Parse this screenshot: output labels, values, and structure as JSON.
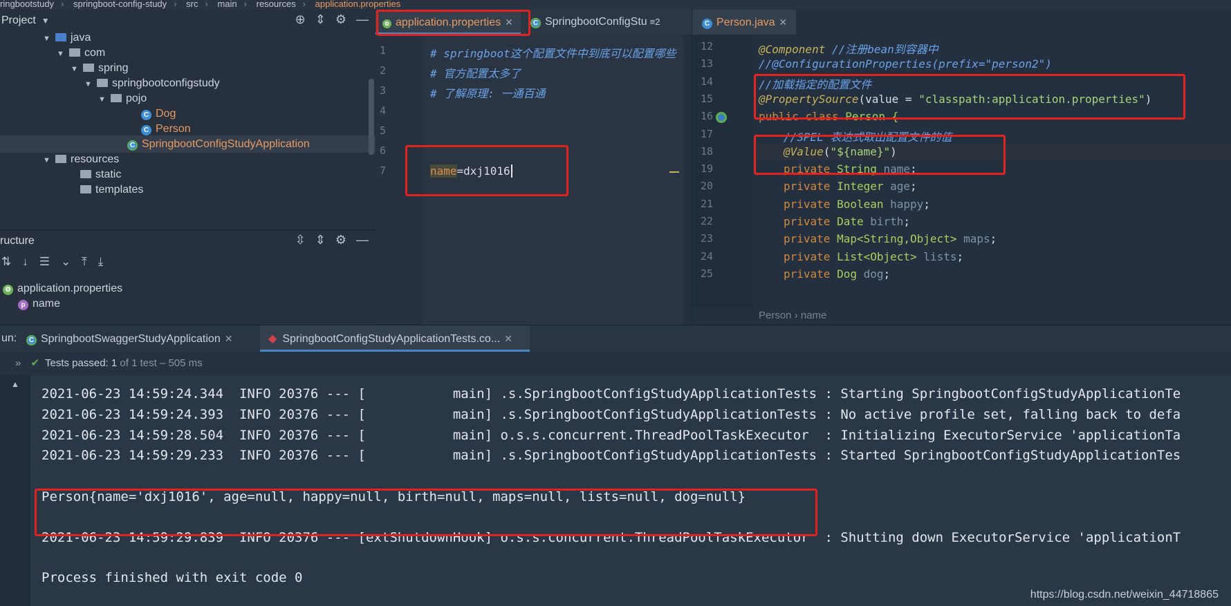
{
  "breadcrumb": [
    "ringbootstudy",
    "springboot-config-study",
    "src",
    "main",
    "resources",
    "application.properties"
  ],
  "project_panel": {
    "title": "Project",
    "tree": [
      {
        "label": "java",
        "icon": "source-folder-icon"
      },
      {
        "label": "com",
        "icon": "package-icon"
      },
      {
        "label": "spring",
        "icon": "package-icon"
      },
      {
        "label": "springbootconfigstudy",
        "icon": "package-icon"
      },
      {
        "label": "pojo",
        "icon": "package-icon"
      },
      {
        "label": "Dog",
        "icon": "class-icon"
      },
      {
        "label": "Person",
        "icon": "class-icon"
      },
      {
        "label": "SpringbootConfigStudyApplication",
        "icon": "spring-boot-class-icon"
      },
      {
        "label": "resources",
        "icon": "resources-folder-icon"
      },
      {
        "label": "static",
        "icon": "folder-icon"
      },
      {
        "label": "templates",
        "icon": "folder-icon"
      }
    ]
  },
  "structure_panel": {
    "title": "ructure",
    "root": "application.properties",
    "child": "name"
  },
  "editor_tabs": [
    {
      "label": "application.properties",
      "active": true
    },
    {
      "label": "SpringbootConfigStu",
      "active": false,
      "overflow": "≡2"
    },
    {
      "label": "Person.java",
      "active": false
    }
  ],
  "props_editor": {
    "lines": [
      {
        "n": "1",
        "text": "# springboot这个配置文件中到底可以配置哪些"
      },
      {
        "n": "2",
        "text": "# 官方配置太多了"
      },
      {
        "n": "3",
        "text": "# 了解原理: 一通百通"
      },
      {
        "n": "4",
        "text": ""
      },
      {
        "n": "5",
        "text": ""
      },
      {
        "n": "6",
        "text": ""
      },
      {
        "n": "7",
        "key": "name",
        "eq": "=",
        "value": "dxj1016"
      }
    ]
  },
  "java_editor": {
    "line_numbers": [
      "12",
      "13",
      "14",
      "15",
      "16",
      "17",
      "18",
      "19",
      "20",
      "21",
      "22",
      "23",
      "24",
      "25"
    ],
    "l12_ann": "@Component",
    "l12_comment": " //注册bean到容器中",
    "l13": "//@ConfigurationProperties(prefix=\"person2\")",
    "l14": "//加载指定的配置文件",
    "l15_ann": "@PropertySource",
    "l15_open": "(value = ",
    "l15_str": "\"classpath:application.properties\"",
    "l15_close": ")",
    "l16_kw": "public class ",
    "l16_name": "Person {",
    "l17": "//SPEL 表达式取出配置文件的值",
    "l18_ann": "@Value",
    "l18_open": "(",
    "l18_str": "\"${name}\"",
    "l18_close": ")",
    "fields": [
      {
        "type": "String",
        "name": "name"
      },
      {
        "type": "Integer",
        "name": "age"
      },
      {
        "type": "Boolean",
        "name": "happy"
      },
      {
        "type": "Date",
        "name": "birth"
      },
      {
        "type": "Map<String,Object>",
        "name": "maps"
      },
      {
        "type": "List<Object>",
        "name": "lists"
      },
      {
        "type": "Dog",
        "name": "dog"
      }
    ],
    "private_kw": "private ",
    "breadcrumb": "Person  ›  name"
  },
  "run_panel": {
    "label": "un:",
    "tabs": [
      "SpringbootSwaggerStudyApplication",
      "SpringbootConfigStudyApplicationTests.co..."
    ],
    "tests_passed": "Tests passed:",
    "tests_count": "1",
    "tests_detail": "of 1 test – 505 ms",
    "console": [
      "2021-06-23 14:59:24.344  INFO 20376 --- [           main] .s.SpringbootConfigStudyApplicationTests : Starting SpringbootConfigStudyApplicationTe",
      "2021-06-23 14:59:24.393  INFO 20376 --- [           main] .s.SpringbootConfigStudyApplicationTests : No active profile set, falling back to defa",
      "2021-06-23 14:59:28.504  INFO 20376 --- [           main] o.s.s.concurrent.ThreadPoolTaskExecutor  : Initializing ExecutorService 'applicationTa",
      "2021-06-23 14:59:29.233  INFO 20376 --- [           main] .s.SpringbootConfigStudyApplicationTests : Started SpringbootConfigStudyApplicationTes",
      "Person{name='dxj1016', age=null, happy=null, birth=null, maps=null, lists=null, dog=null}",
      "2021-06-23 14:59:29.839  INFO 20376 --- [extShutdownHook] o.s.s.concurrent.ThreadPoolTaskExecutor  : Shutting down ExecutorService 'applicationT",
      "Process finished with exit code 0"
    ]
  },
  "watermark": "https://blog.csdn.net/weixin_44718865",
  "colors": {
    "highlight_box": "#e0231f",
    "accent": "#4a88c7"
  }
}
